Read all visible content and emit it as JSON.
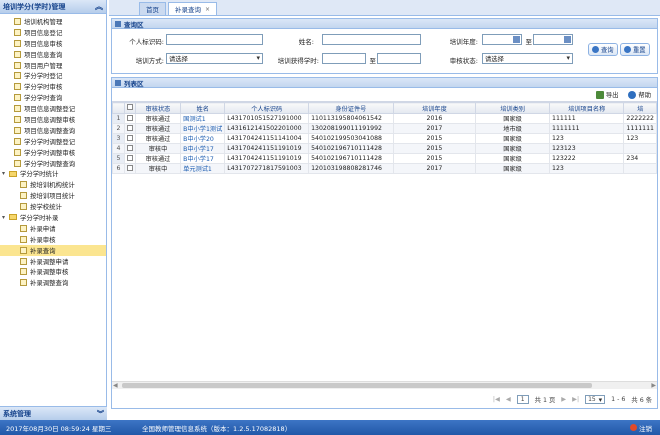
{
  "sidebar": {
    "header": "培训学分(学时)管理",
    "items": [
      {
        "label": "培训机构管理",
        "level": 1,
        "kind": "item"
      },
      {
        "label": "项目信息登记",
        "level": 1,
        "kind": "item"
      },
      {
        "label": "项目信息审核",
        "level": 1,
        "kind": "item"
      },
      {
        "label": "项目信息查询",
        "level": 1,
        "kind": "item"
      },
      {
        "label": "项目用户管理",
        "level": 1,
        "kind": "item"
      },
      {
        "label": "学分学时登记",
        "level": 1,
        "kind": "item"
      },
      {
        "label": "学分学时审核",
        "level": 1,
        "kind": "item"
      },
      {
        "label": "学分学时查询",
        "level": 1,
        "kind": "item"
      },
      {
        "label": "项目信息调整登记",
        "level": 1,
        "kind": "item"
      },
      {
        "label": "项目信息调整审核",
        "level": 1,
        "kind": "item"
      },
      {
        "label": "项目信息调整查询",
        "level": 1,
        "kind": "item"
      },
      {
        "label": "学分学时调整登记",
        "level": 1,
        "kind": "item"
      },
      {
        "label": "学分学时调整审核",
        "level": 1,
        "kind": "item"
      },
      {
        "label": "学分学时调整查询",
        "level": 1,
        "kind": "item"
      },
      {
        "label": "学分学时统计",
        "level": 0,
        "kind": "folder"
      },
      {
        "label": "按培训机构统计",
        "level": 2,
        "kind": "item"
      },
      {
        "label": "按培训项目统计",
        "level": 2,
        "kind": "item"
      },
      {
        "label": "按学校统计",
        "level": 2,
        "kind": "item"
      },
      {
        "label": "学分学时补录",
        "level": 0,
        "kind": "folder"
      },
      {
        "label": "补录申请",
        "level": 2,
        "kind": "item"
      },
      {
        "label": "补录审核",
        "level": 2,
        "kind": "item"
      },
      {
        "label": "补录查询",
        "level": 2,
        "kind": "item",
        "selected": true
      },
      {
        "label": "补录调整申请",
        "level": 2,
        "kind": "item"
      },
      {
        "label": "补录调整审核",
        "level": 2,
        "kind": "item"
      },
      {
        "label": "补录调整查询",
        "level": 2,
        "kind": "item"
      }
    ],
    "footer": "系统管理"
  },
  "tabs": [
    {
      "label": "首页",
      "active": false
    },
    {
      "label": "补录查询",
      "active": true,
      "close": "×"
    }
  ],
  "query": {
    "title": "查询区",
    "personal_id_label": "个人标识码:",
    "personal_id_value": "",
    "name_label": "姓名:",
    "name_value": "",
    "year_label": "培训年度:",
    "year_to": "至",
    "method_label": "培训方式:",
    "method_value": "请选择",
    "hours_label": "培训获得学时:",
    "hours_to": "至",
    "review_label": "审核状态:",
    "review_value": "请选择",
    "search_button": "查询",
    "reset_button": "重置"
  },
  "list": {
    "title": "列表区",
    "export": "导出",
    "help": "帮助",
    "columns": [
      "",
      "审核状态",
      "姓名",
      "个人标识码",
      "身份证件号",
      "培训年度",
      "培训类别",
      "培训项目名称",
      "培"
    ],
    "rows": [
      {
        "n": "1",
        "status": "审核通过",
        "name": "国测试1",
        "pid": "L431701051527191000",
        "idno": "110113195804061542",
        "year": "2016",
        "cat": "国家级",
        "proj": "111111",
        "extra": "2222222"
      },
      {
        "n": "2",
        "status": "审核通过",
        "name": "B中小学1测试",
        "pid": "L431612141502201000",
        "idno": "130208199011191992",
        "year": "2017",
        "cat": "地市级",
        "proj": "1111111",
        "extra": "1111111"
      },
      {
        "n": "3",
        "status": "审核通过",
        "name": "B中小学20",
        "pid": "L431704241151141004",
        "idno": "540102199503041088",
        "year": "2015",
        "cat": "国家级",
        "proj": "123",
        "extra": "123"
      },
      {
        "n": "4",
        "status": "审核中",
        "name": "B中小学17",
        "pid": "L431704241151191019",
        "idno": "540102196710111428",
        "year": "2015",
        "cat": "国家级",
        "proj": "123123",
        "extra": ""
      },
      {
        "n": "5",
        "status": "审核通过",
        "name": "B中小学17",
        "pid": "L431704241151191019",
        "idno": "540102196710111428",
        "year": "2015",
        "cat": "国家级",
        "proj": "123222",
        "extra": "234"
      },
      {
        "n": "6",
        "status": "审核中",
        "name": "单元测试1",
        "pid": "L431707271817591003",
        "idno": "120103198808281746",
        "year": "2017",
        "cat": "国家级",
        "proj": "123",
        "extra": ""
      }
    ],
    "pager": {
      "page": "1",
      "total_pages": "共 1 页",
      "page_size": "15",
      "range": "1 - 6",
      "total": "共 6 条"
    }
  },
  "status_bar": {
    "datetime": "2017年08月30日  08:59:24  星期三",
    "system": "全国教师管理信息系统（版本：1.2.5.17082818）",
    "logout": "注销"
  }
}
